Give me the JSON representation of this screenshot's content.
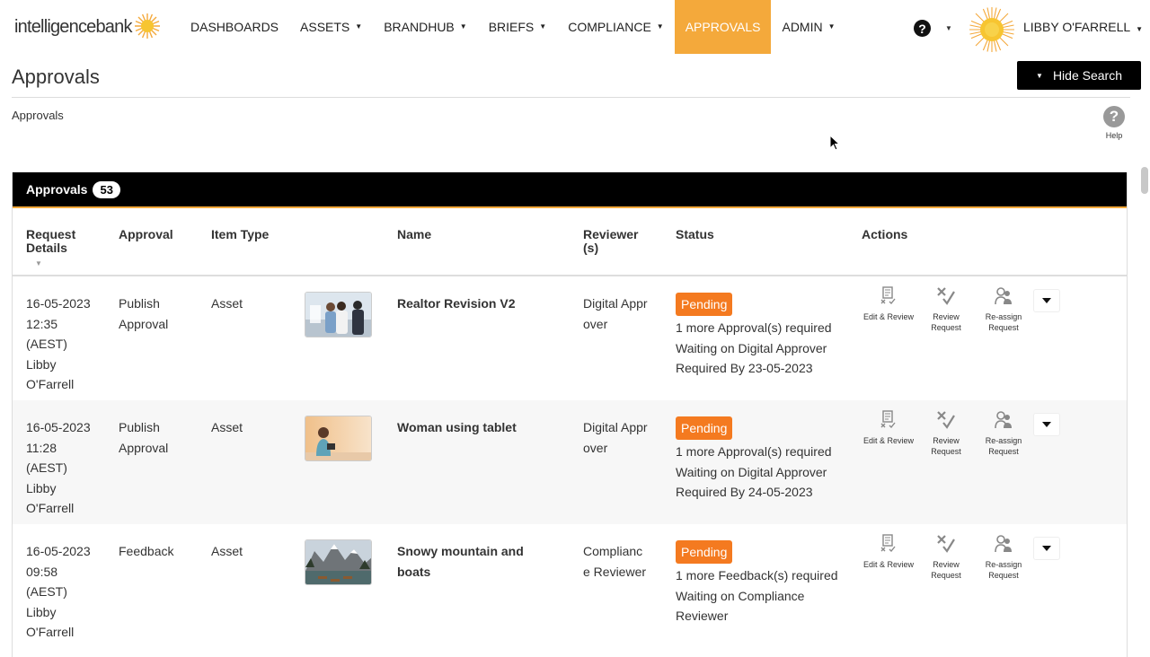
{
  "brand": {
    "name": "intelligencebank",
    "accent": "#f4a93b",
    "badge_color": "#f47a20"
  },
  "nav": {
    "items": [
      {
        "label": "DASHBOARDS",
        "caret": false
      },
      {
        "label": "ASSETS",
        "caret": true
      },
      {
        "label": "BRANDHUB",
        "caret": true
      },
      {
        "label": "BRIEFS",
        "caret": true
      },
      {
        "label": "COMPLIANCE",
        "caret": true
      },
      {
        "label": "APPROVALS",
        "caret": false,
        "active": true
      },
      {
        "label": "ADMIN",
        "caret": true
      }
    ],
    "help_icon": "question-circle-icon",
    "user": "LIBBY O'FARRELL"
  },
  "header": {
    "title": "Approvals",
    "hide_search": "Hide Search",
    "breadcrumb": "Approvals",
    "help_label": "Help"
  },
  "panel": {
    "title": "Approvals",
    "count": "53",
    "columns": [
      "Request Details",
      "Approval",
      "Item Type",
      "Name",
      "Reviewer(s)",
      "Status",
      "Actions"
    ],
    "action_labels": [
      "Edit & Review",
      "Review Request",
      "Re-assign Request"
    ]
  },
  "rows": [
    {
      "date": "16-05-2023",
      "time": "12:35",
      "tz": "(AEST)",
      "user_first": "Libby",
      "user_last": "O'Farrell",
      "approval": "Publish Approval",
      "item_type": "Asset",
      "name": "Realtor Revision V2",
      "reviewer": "Digital Approver",
      "status": "Pending",
      "status_lines": [
        "1 more Approval(s) required",
        "Waiting on Digital Approver",
        "Required By 23-05-2023"
      ],
      "thumb": "couple-realtor-photo"
    },
    {
      "date": "16-05-2023",
      "time": "11:28",
      "tz": "(AEST)",
      "user_first": "Libby",
      "user_last": "O'Farrell",
      "approval": "Publish Approval",
      "item_type": "Asset",
      "name": "Woman using tablet",
      "reviewer": "Digital Approver",
      "status": "Pending",
      "status_lines": [
        "1 more Approval(s) required",
        "Waiting on Digital Approver",
        "Required By 24-05-2023"
      ],
      "thumb": "woman-tablet-photo"
    },
    {
      "date": "16-05-2023",
      "time": "09:58",
      "tz": "(AEST)",
      "user_first": "Libby",
      "user_last": "O'Farrell",
      "approval": "Feedback",
      "item_type": "Asset",
      "name": "Snowy mountain and boats",
      "reviewer": "Compliance Reviewer",
      "status": "Pending",
      "status_lines": [
        "1 more Feedback(s) required",
        "Waiting on Compliance Reviewer"
      ],
      "thumb": "mountain-lake-photo"
    }
  ]
}
